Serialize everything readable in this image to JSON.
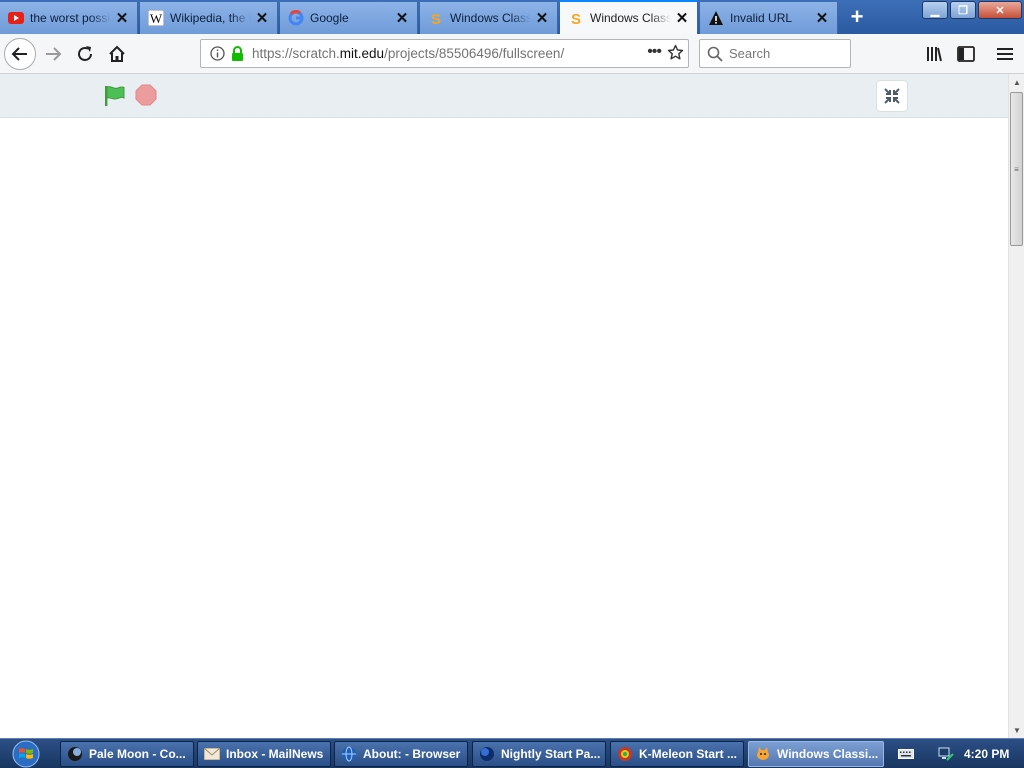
{
  "browser": {
    "tabs": [
      {
        "title": "the worst possible",
        "icon": "youtube-icon"
      },
      {
        "title": "Wikipedia, the free",
        "icon": "wikipedia-icon"
      },
      {
        "title": "Google",
        "icon": "google-icon"
      },
      {
        "title": "Windows Classic",
        "icon": "scratch-icon"
      },
      {
        "title": "Windows Classic",
        "icon": "scratch-icon",
        "active": true
      },
      {
        "title": "Invalid URL",
        "icon": "warning-icon"
      }
    ],
    "url": {
      "prefix": "https://scratch.",
      "domain": "mit.edu",
      "path": "/projects/85506496/fullscreen/"
    },
    "search_placeholder": "Search"
  },
  "taskbar": {
    "items": [
      {
        "label": "Pale Moon - Co...",
        "icon": "palemoon-icon"
      },
      {
        "label": "Inbox - MailNews",
        "icon": "mail-icon"
      },
      {
        "label": "About: - Browser",
        "icon": "globe-icon"
      },
      {
        "label": "Nightly Start Pa...",
        "icon": "nightly-icon"
      },
      {
        "label": "K-Meleon Start ...",
        "icon": "kmeleon-icon"
      },
      {
        "label": "Windows Classi...",
        "icon": "scratch-cat-icon",
        "active": true
      }
    ],
    "clock": "4:20 PM"
  },
  "colors": {
    "tabstrip": "#2a5aa0",
    "accent": "#0a84ff",
    "flag_green": "#4cbf56",
    "stop_red": "#ec9c9c",
    "lock_green": "#12bc00"
  }
}
